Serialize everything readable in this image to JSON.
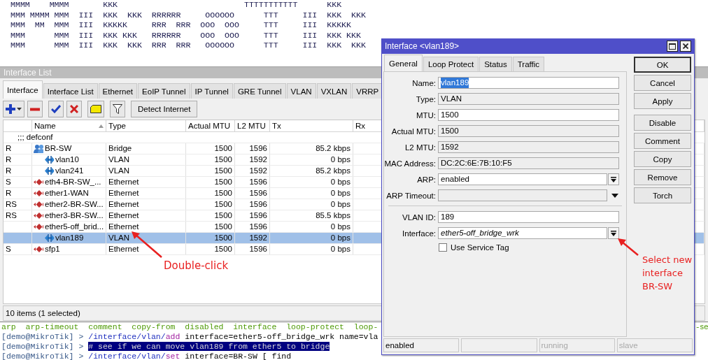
{
  "terminal": {
    "logo_lines": [
      "MMMM    MMMM       KKK                          TTTTTTTTTTT      KKK",
      "MMM MMMM MMM  III  KKK  KKK  RRRRRR     OOOOOO      TTT     III  KKK  KKK",
      "MMM  MM  MMM  III  KKKKK     RRR  RRR  OOO  OOO     TTT     III  KKKKK",
      "MMM      MMM  III  KKK KKK   RRRRRR    OOO  OOO     TTT     III  KKK KKK",
      "MMM      MMM  III  KKK  KKK  RRR  RRR   OOOOOO      TTT     III  KKK  KKK"
    ],
    "lines": [
      {
        "segments": [
          {
            "kind": "hint",
            "text": "arp  arp-timeout  comment  copy-from  disabled  interface  loop-protect  loop-"
          }
        ],
        "right_fragment": "-se"
      },
      {
        "segments": [
          {
            "kind": "prompt",
            "text": "[demo@MikroTik] > "
          },
          {
            "kind": "path",
            "text": "/interface/vlan/"
          },
          {
            "kind": "verb",
            "text": "add"
          },
          {
            "kind": "plain",
            "text": " interface=ether5-off_bridge_wrk name=vla"
          }
        ]
      },
      {
        "segments": [
          {
            "kind": "prompt",
            "text": "[demo@MikroTik] > "
          },
          {
            "kind": "selection",
            "text": "# see if we can move vlan189 from ether5 to bridge"
          }
        ]
      },
      {
        "segments": [
          {
            "kind": "prompt",
            "text": "[demo@MikroTik] > "
          },
          {
            "kind": "path",
            "text": "/interface/vlan/"
          },
          {
            "kind": "verb",
            "text": "set"
          },
          {
            "kind": "plain",
            "text": " interface=BR-SW [ find"
          }
        ]
      }
    ]
  },
  "interface_list": {
    "title": "Interface List",
    "tabs": [
      {
        "label": "Interface",
        "selected": true
      },
      {
        "label": "Interface List",
        "selected": false
      },
      {
        "label": "Ethernet",
        "selected": false
      },
      {
        "label": "EoIP Tunnel",
        "selected": false
      },
      {
        "label": "IP Tunnel",
        "selected": false
      },
      {
        "label": "GRE Tunnel",
        "selected": false
      },
      {
        "label": "VLAN",
        "selected": false
      },
      {
        "label": "VXLAN",
        "selected": false
      },
      {
        "label": "VRRP",
        "selected": false
      }
    ],
    "toolbar": [
      {
        "kind": "add"
      },
      {
        "kind": "remove"
      },
      {
        "kind": "enable"
      },
      {
        "kind": "disable"
      },
      {
        "kind": "comment"
      },
      {
        "kind": "filter"
      },
      {
        "kind": "text",
        "label": "Detect Internet"
      }
    ],
    "table": {
      "columns": [
        {
          "label": "Name",
          "sorted": true
        },
        {
          "label": "Type",
          "sorted": false
        },
        {
          "label": "Actual MTU",
          "sorted": false
        },
        {
          "label": "L2 MTU",
          "sorted": false
        },
        {
          "label": "Tx",
          "sorted": false
        },
        {
          "label": "Rx",
          "sorted": false
        }
      ],
      "rows": [
        {
          "kind": "group",
          "label": ";;; defconf",
          "selected": false
        },
        {
          "kind": "bridge",
          "flags": "R",
          "name": "BR-SW",
          "type": "Bridge",
          "actual_mtu": "1500",
          "l2_mtu": "1596",
          "tx": "85.2 kbps",
          "selected": false,
          "children": [
            {
              "kind": "vlan",
              "flags": "R",
              "name": "vlan10",
              "type": "VLAN",
              "actual_mtu": "1500",
              "l2_mtu": "1592",
              "tx": "0 bps",
              "selected": false
            },
            {
              "kind": "vlan",
              "flags": "R",
              "name": "vlan241",
              "type": "VLAN",
              "actual_mtu": "1500",
              "l2_mtu": "1592",
              "tx": "85.2 kbps",
              "selected": false
            }
          ]
        },
        {
          "kind": "ethernet",
          "flags": "S",
          "name": "eth4-BR-SW_...",
          "type": "Ethernet",
          "actual_mtu": "1500",
          "l2_mtu": "1596",
          "tx": "0 bps",
          "selected": false
        },
        {
          "kind": "ethernet",
          "flags": "R",
          "name": "ether1-WAN",
          "type": "Ethernet",
          "actual_mtu": "1500",
          "l2_mtu": "1596",
          "tx": "0 bps",
          "selected": false
        },
        {
          "kind": "ethernet",
          "flags": "RS",
          "name": "ether2-BR-SW...",
          "type": "Ethernet",
          "actual_mtu": "1500",
          "l2_mtu": "1596",
          "tx": "0 bps",
          "selected": false
        },
        {
          "kind": "ethernet",
          "flags": "RS",
          "name": "ether3-BR-SW...",
          "type": "Ethernet",
          "actual_mtu": "1500",
          "l2_mtu": "1596",
          "tx": "85.5 kbps",
          "selected": false
        },
        {
          "kind": "ethernet",
          "name": "ether5-off_brid...",
          "type": "Ethernet",
          "actual_mtu": "1500",
          "l2_mtu": "1596",
          "tx": "0 bps",
          "selected": false,
          "children": [
            {
              "kind": "vlan",
              "name": "vlan189",
              "type": "VLAN",
              "actual_mtu": "1500",
              "l2_mtu": "1592",
              "tx": "0 bps",
              "selected": true
            }
          ]
        },
        {
          "kind": "ethernet",
          "flags": "S",
          "name": "sfp1",
          "type": "Ethernet",
          "actual_mtu": "1500",
          "l2_mtu": "1596",
          "tx": "0 bps",
          "selected": false
        }
      ]
    },
    "status_text": "10 items (1 selected)"
  },
  "dialog": {
    "title": "Interface <vlan189>",
    "tabs": [
      {
        "label": "General",
        "selected": true
      },
      {
        "label": "Loop Protect",
        "selected": false
      },
      {
        "label": "Status",
        "selected": false
      },
      {
        "label": "Traffic",
        "selected": false
      }
    ],
    "field_groups": [
      [
        {
          "kind": "input",
          "label": "Name:",
          "value": "vlan189",
          "value_selected": true
        },
        {
          "kind": "readonly",
          "label": "Type:",
          "value": "VLAN"
        },
        {
          "kind": "input",
          "label": "MTU:",
          "value": "1500"
        },
        {
          "kind": "readonly",
          "label": "Actual MTU:",
          "value": "1500"
        },
        {
          "kind": "readonly",
          "label": "L2 MTU:",
          "value": "1592"
        },
        {
          "kind": "readonly",
          "label": "MAC Address:",
          "value": "DC:2C:6E:7B:10:F5"
        },
        {
          "kind": "select",
          "label": "ARP:",
          "value": "enabled"
        },
        {
          "kind": "readonly_select",
          "label": "ARP Timeout:"
        }
      ],
      [
        {
          "kind": "input",
          "label": "VLAN ID:",
          "value": "189"
        },
        {
          "kind": "select",
          "label": "Interface:",
          "value": "ether5-off_bridge_wrk",
          "italic": true
        }
      ]
    ],
    "checkbox": {
      "label": "Use Service Tag",
      "checked": false
    },
    "button_groups": [
      [
        {
          "label": "OK",
          "default": true
        },
        {
          "label": "Cancel",
          "default": false
        },
        {
          "label": "Apply",
          "default": false
        }
      ],
      [
        {
          "label": "Disable",
          "default": false
        },
        {
          "label": "Comment",
          "default": false
        },
        {
          "label": "Copy",
          "default": false
        },
        {
          "label": "Remove",
          "default": false
        },
        {
          "label": "Torch",
          "default": false
        }
      ]
    ],
    "status": [
      {
        "kind": "text",
        "text": "enabled",
        "dimmed": false
      },
      {
        "kind": "blank"
      },
      {
        "kind": "text",
        "text": "running",
        "dimmed": true
      },
      {
        "kind": "text",
        "text": "slave",
        "dimmed": true
      }
    ]
  },
  "annotations": [
    {
      "kind": "row_hint",
      "text": "Double-click"
    },
    {
      "kind": "dropdown_hint",
      "text": "Select new interface BR-SW"
    }
  ]
}
